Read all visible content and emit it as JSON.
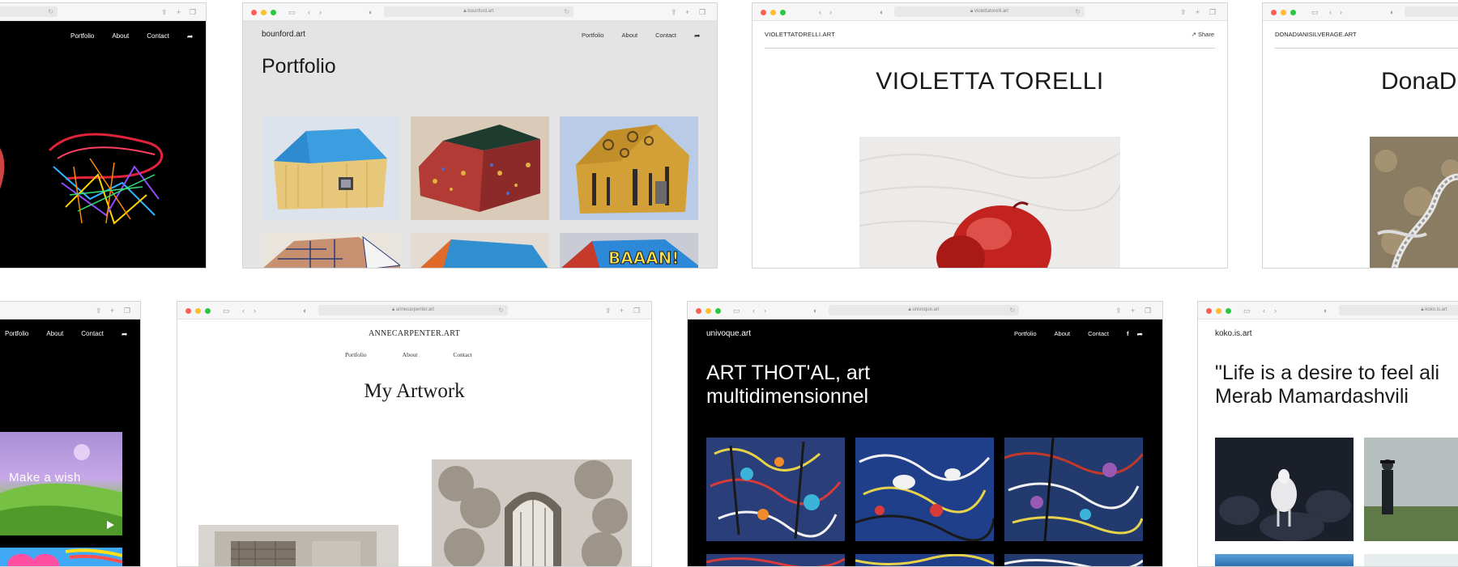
{
  "windows": {
    "w1": {
      "nav": [
        "Portfolio",
        "About",
        "Contact"
      ]
    },
    "w2": {
      "url": "bounford.art",
      "logo": "bounford.art",
      "nav": [
        "Portfolio",
        "About",
        "Contact"
      ],
      "heading": "Portfolio"
    },
    "w3": {
      "url": "violettatorelli.art",
      "logo": "VIOLETTATORELLI.ART",
      "share": "Share",
      "heading": "VIOLETTA TORELLI"
    },
    "w4": {
      "logo": "DONADIANISILVERAGE.ART",
      "heading": "DonaD"
    },
    "w5": {
      "nav": [
        "Portfolio",
        "About",
        "Contact"
      ],
      "overlay_text": "Make a wish"
    },
    "w6": {
      "url": "annecarpenter.art",
      "logo": "ANNECARPENTER.ART",
      "nav": [
        "Portfolio",
        "About",
        "Contact"
      ],
      "heading": "My Artwork"
    },
    "w7": {
      "url": "univoque.art",
      "logo": "univoque.art",
      "nav": [
        "Portfolio",
        "About",
        "Contact"
      ],
      "facebook": "f",
      "heading_line1": "ART THOT'AL, art",
      "heading_line2": "multidimensionnel"
    },
    "w8": {
      "url": "koko.is.art",
      "logo": "koko.is.art",
      "heading_line1": "\"Life is a desire to feel ali",
      "heading_line2": "Merab Mamardashvili"
    }
  },
  "icons": {
    "share": "share-icon",
    "reload": "reload-icon",
    "lock": "lock-icon",
    "sidebar": "sidebar-icon",
    "back": "back-icon",
    "forward": "forward-icon",
    "tabs": "tabs-icon",
    "new_tab": "new-tab-icon",
    "privacy": "privacy-shield-icon",
    "play": "play-icon",
    "facebook": "facebook-icon"
  },
  "colors": {
    "close": "#fe5f57",
    "minimize": "#febc2e",
    "maximize": "#28c840",
    "dark_bg": "#000000",
    "light_gray_bg": "#e4e4e4"
  }
}
